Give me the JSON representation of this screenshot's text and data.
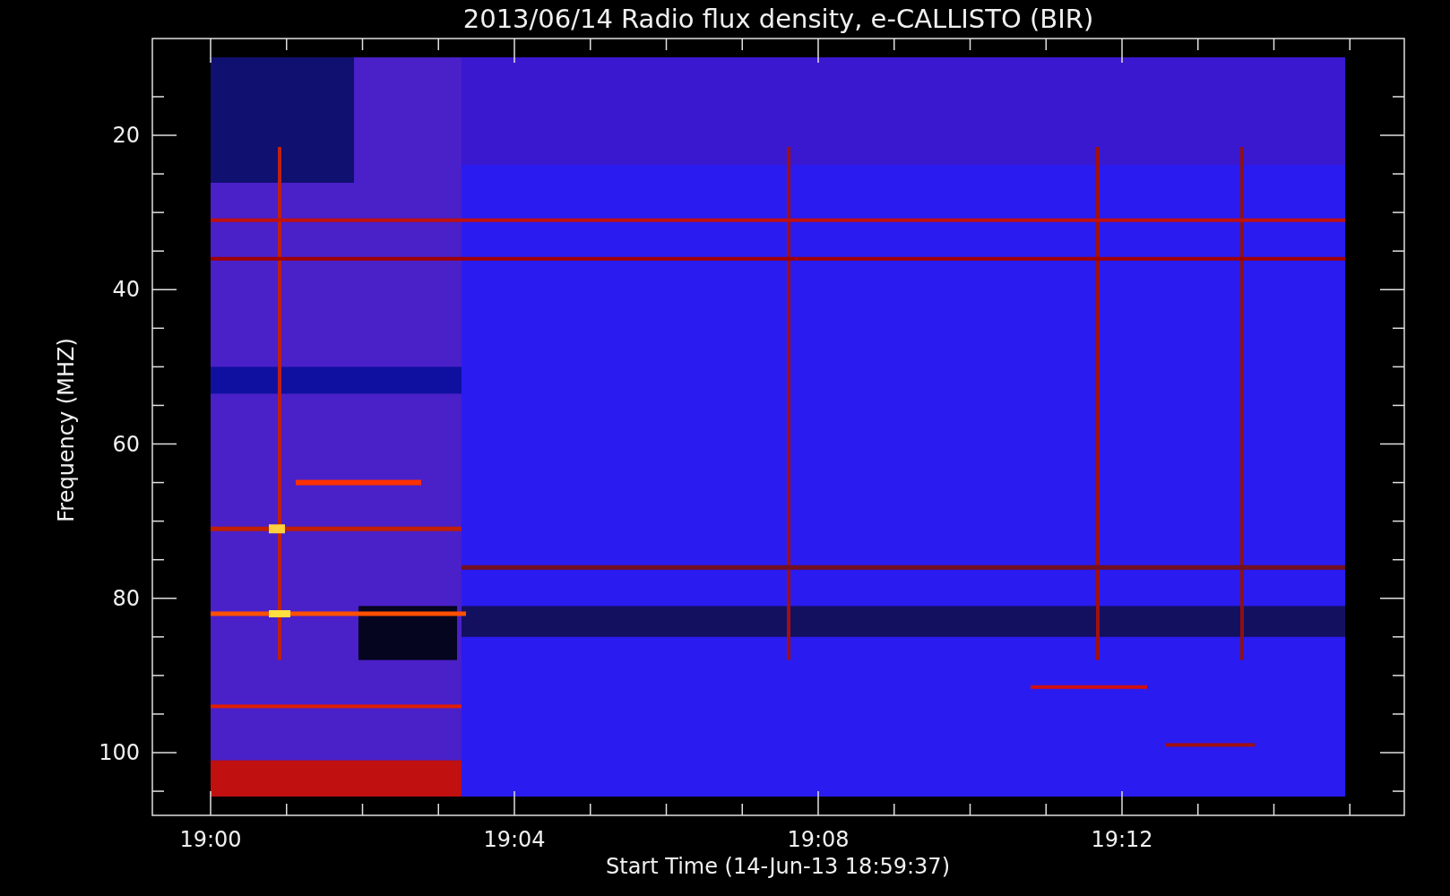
{
  "title": "2013/06/14  Radio flux density, e-CALLISTO (BIR)",
  "y_axis": {
    "label": "Frequency (MHZ)",
    "ticks": [
      "20",
      "40",
      "60",
      "80",
      "100"
    ]
  },
  "x_axis": {
    "label": "Start Time (14-Jun-13 18:59:37)",
    "ticks": [
      "19:00",
      "19:04",
      "19:08",
      "19:12"
    ]
  }
}
